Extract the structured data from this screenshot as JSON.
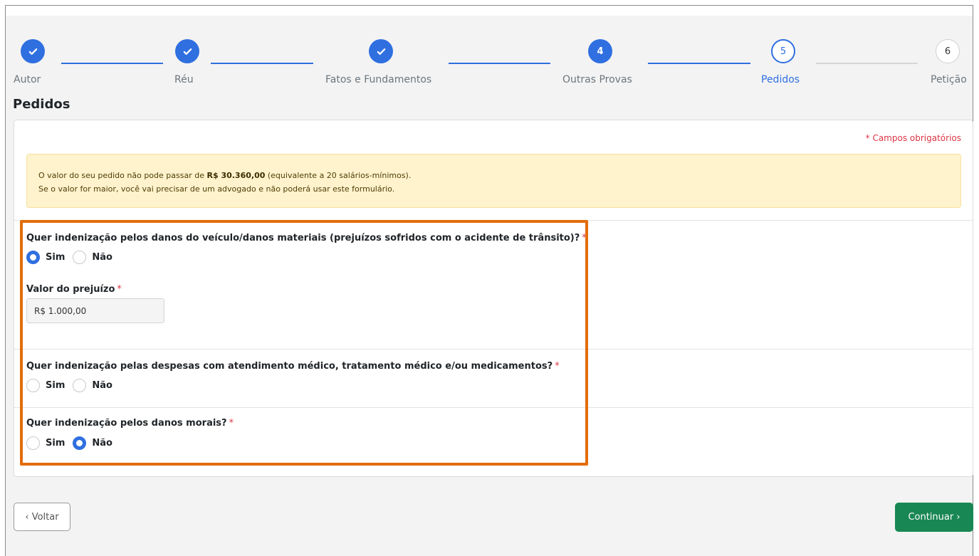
{
  "stepper": {
    "steps": [
      {
        "label": "Autor",
        "status": "done",
        "icon": "check-icon"
      },
      {
        "label": "Réu",
        "status": "done",
        "icon": "check-icon"
      },
      {
        "label": "Fatos e Fundamentos",
        "status": "done",
        "icon": "check-icon"
      },
      {
        "label": "Outras Provas",
        "status": "current",
        "number": "4"
      },
      {
        "label": "Pedidos",
        "status": "active",
        "number": "5"
      },
      {
        "label": "Petição",
        "status": "todo",
        "number": "6"
      }
    ]
  },
  "page": {
    "title": "Pedidos"
  },
  "form": {
    "required_note": "* Campos obrigatórios",
    "alert": {
      "line1_prefix": "O valor do seu pedido não pode passar de ",
      "line1_amount": "R$ 30.360,00",
      "line1_suffix": " (equivalente a 20 salários-mínimos).",
      "line2": "Se o valor for maior, você vai precisar de um advogado e não poderá usar este formulário."
    },
    "q1": {
      "label": "Quer indenização pelos danos do veículo/danos materiais (prejuízos sofridos com o acidente de trânsito)?",
      "required_mark": "*",
      "options": [
        "Sim",
        "Não"
      ],
      "selected": "Sim"
    },
    "value_field": {
      "label": "Valor do prejuízo",
      "required_mark": "*",
      "value": "R$ 1.000,00"
    },
    "q2": {
      "label": "Quer indenização pelas despesas com atendimento médico, tratamento médico e/ou medicamentos?",
      "required_mark": "*",
      "options": [
        "Sim",
        "Não"
      ],
      "selected": null
    },
    "q3": {
      "label": "Quer indenização pelos danos morais?",
      "required_mark": "*",
      "options": [
        "Sim",
        "Não"
      ],
      "selected": "Não"
    }
  },
  "nav": {
    "back_label": "‹ Voltar",
    "next_label": "Continuar ›"
  },
  "colors": {
    "primary": "#2f6fe0",
    "success": "#198754",
    "danger": "#dc3545",
    "alert_bg": "#fff3cd",
    "highlight": "#e36c0a"
  }
}
